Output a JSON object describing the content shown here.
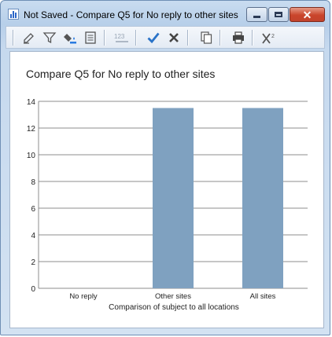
{
  "window": {
    "title": "Not Saved - Compare Q5 for No reply to other sites",
    "close_glyph": "✕"
  },
  "toolbar": {
    "items": [
      "edit-icon",
      "filter-icon",
      "fill-icon",
      "notes-icon",
      "number-format-icon",
      "apply-check-icon",
      "cancel-x-icon",
      "copy-icon",
      "print-icon",
      "chi-square-icon"
    ]
  },
  "colors": {
    "bar": "#7fa1c0",
    "grid": "#8c8c8c",
    "accent": "#2a66c8"
  },
  "chart_data": {
    "type": "bar",
    "title": "Compare Q5 for No reply to other sites",
    "xlabel": "Comparison of subject to all locations",
    "ylabel": "",
    "categories": [
      "No reply",
      "Other sites",
      "All sites"
    ],
    "values": [
      0,
      13.5,
      13.5
    ],
    "ylim": [
      0,
      14
    ],
    "yticks": [
      0,
      2,
      4,
      6,
      8,
      10,
      12,
      14
    ],
    "grid": true,
    "legend": "none"
  }
}
